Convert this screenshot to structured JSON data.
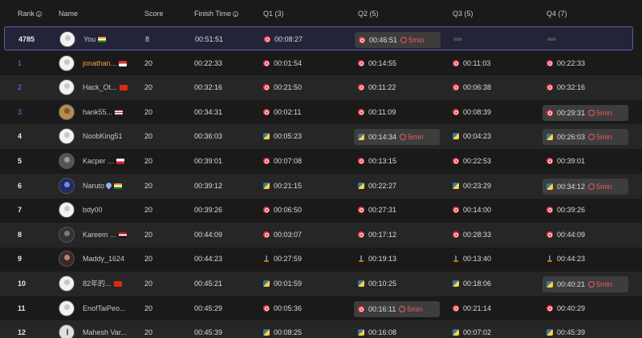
{
  "header": {
    "rank": "Rank",
    "name": "Name",
    "score": "Score",
    "finish": "Finish Time",
    "q1": "Q1 (3)",
    "q2": "Q2 (5)",
    "q3": "Q3 (5)",
    "q4": "Q4 (7)"
  },
  "icons": {
    "info": "info-icon",
    "cpp": "cpp-lang-icon",
    "python": "python-lang-icon",
    "java": "java-lang-icon",
    "penalty": "penalty-clock-icon"
  },
  "colors": {
    "highlight_border": "#5c5fa6",
    "top_rank": "#5b7cff",
    "gold_name": "#f0a43a",
    "penalty": "#f05b5b"
  },
  "me": {
    "rank": "4785",
    "name": "You",
    "flag": "in",
    "score": "8",
    "finish": "00:51:51",
    "q1": {
      "time": "00:08:27",
      "lang": "cpp"
    },
    "q2": {
      "time": "00:46:51",
      "lang": "cpp",
      "penalty": "5min"
    },
    "q3": {
      "time": "",
      "lang": ""
    },
    "q4": {
      "time": "",
      "lang": ""
    }
  },
  "rows": [
    {
      "rank": "1",
      "name": "jonathan...",
      "flag": "id",
      "score": "20",
      "finish": "00:22:33",
      "q1": {
        "time": "00:01:54",
        "lang": "cpp"
      },
      "q2": {
        "time": "00:14:55",
        "lang": "cpp"
      },
      "q3": {
        "time": "00:11:03",
        "lang": "cpp"
      },
      "q4": {
        "time": "00:22:33",
        "lang": "cpp"
      }
    },
    {
      "rank": "2",
      "name": "Hack_Ot...",
      "flag": "cn",
      "score": "20",
      "finish": "00:32:16",
      "q1": {
        "time": "00:21:50",
        "lang": "cpp"
      },
      "q2": {
        "time": "00:11:22",
        "lang": "cpp"
      },
      "q3": {
        "time": "00:06:38",
        "lang": "cpp"
      },
      "q4": {
        "time": "00:32:16",
        "lang": "cpp"
      }
    },
    {
      "rank": "3",
      "name": "hank55...",
      "flag": "us",
      "score": "20",
      "finish": "00:34:31",
      "q1": {
        "time": "00:02:11",
        "lang": "cpp"
      },
      "q2": {
        "time": "00:11:09",
        "lang": "cpp"
      },
      "q3": {
        "time": "00:08:39",
        "lang": "cpp"
      },
      "q4": {
        "time": "00:29:31",
        "lang": "cpp",
        "penalty": "5min"
      }
    },
    {
      "rank": "4",
      "name": "NoobKing51",
      "flag": "",
      "score": "20",
      "finish": "00:36:03",
      "q1": {
        "time": "00:05:23",
        "lang": "py"
      },
      "q2": {
        "time": "00:14:34",
        "lang": "py",
        "penalty": "5min"
      },
      "q3": {
        "time": "00:04:23",
        "lang": "py"
      },
      "q4": {
        "time": "00:26:03",
        "lang": "py",
        "penalty": "5min"
      }
    },
    {
      "rank": "5",
      "name": "Kacper ...",
      "flag": "pl",
      "score": "20",
      "finish": "00:39:01",
      "q1": {
        "time": "00:07:08",
        "lang": "cpp"
      },
      "q2": {
        "time": "00:13:15",
        "lang": "cpp"
      },
      "q3": {
        "time": "00:22:53",
        "lang": "cpp"
      },
      "q4": {
        "time": "00:39:01",
        "lang": "cpp"
      }
    },
    {
      "rank": "6",
      "name": "Naruto",
      "flag": "in",
      "score": "20",
      "finish": "00:39:12",
      "q1": {
        "time": "00:21:15",
        "lang": "py"
      },
      "q2": {
        "time": "00:22:27",
        "lang": "py"
      },
      "q3": {
        "time": "00:23:29",
        "lang": "py"
      },
      "q4": {
        "time": "00:34:12",
        "lang": "py",
        "penalty": "5min"
      }
    },
    {
      "rank": "7",
      "name": "bdy00",
      "flag": "",
      "score": "20",
      "finish": "00:39:26",
      "q1": {
        "time": "00:06:50",
        "lang": "cpp"
      },
      "q2": {
        "time": "00:27:31",
        "lang": "cpp"
      },
      "q3": {
        "time": "00:14:00",
        "lang": "cpp"
      },
      "q4": {
        "time": "00:39:26",
        "lang": "cpp"
      }
    },
    {
      "rank": "8",
      "name": "Kareem ...",
      "flag": "eg",
      "score": "20",
      "finish": "00:44:09",
      "q1": {
        "time": "00:03:07",
        "lang": "cpp"
      },
      "q2": {
        "time": "00:17:12",
        "lang": "cpp"
      },
      "q3": {
        "time": "00:28:33",
        "lang": "cpp"
      },
      "q4": {
        "time": "00:44:09",
        "lang": "cpp"
      }
    },
    {
      "rank": "9",
      "name": "Maddy_1624",
      "flag": "",
      "score": "20",
      "finish": "00:44:23",
      "q1": {
        "time": "00:27:59",
        "lang": "java"
      },
      "q2": {
        "time": "00:19:13",
        "lang": "java"
      },
      "q3": {
        "time": "00:13:40",
        "lang": "java"
      },
      "q4": {
        "time": "00:44:23",
        "lang": "java"
      }
    },
    {
      "rank": "10",
      "name": "82年的...",
      "flag": "cn",
      "score": "20",
      "finish": "00:45:21",
      "q1": {
        "time": "00:01:59",
        "lang": "py"
      },
      "q2": {
        "time": "00:10:25",
        "lang": "py"
      },
      "q3": {
        "time": "00:18:06",
        "lang": "py"
      },
      "q4": {
        "time": "00:40:21",
        "lang": "py",
        "penalty": "5min"
      }
    },
    {
      "rank": "11",
      "name": "EnofTaiPeo...",
      "flag": "",
      "score": "20",
      "finish": "00:45:29",
      "q1": {
        "time": "00:05:36",
        "lang": "cpp"
      },
      "q2": {
        "time": "00:16:11",
        "lang": "cpp",
        "penalty": "5min"
      },
      "q3": {
        "time": "00:21:14",
        "lang": "cpp"
      },
      "q4": {
        "time": "00:40:29",
        "lang": "cpp"
      }
    },
    {
      "rank": "12",
      "name": "Mahesh Var...",
      "flag": "",
      "score": "20",
      "finish": "00:45:39",
      "q1": {
        "time": "00:08:25",
        "lang": "py"
      },
      "q2": {
        "time": "00:16:08",
        "lang": "py"
      },
      "q3": {
        "time": "00:07:02",
        "lang": "py"
      },
      "q4": {
        "time": "00:45:39",
        "lang": "py"
      }
    }
  ]
}
